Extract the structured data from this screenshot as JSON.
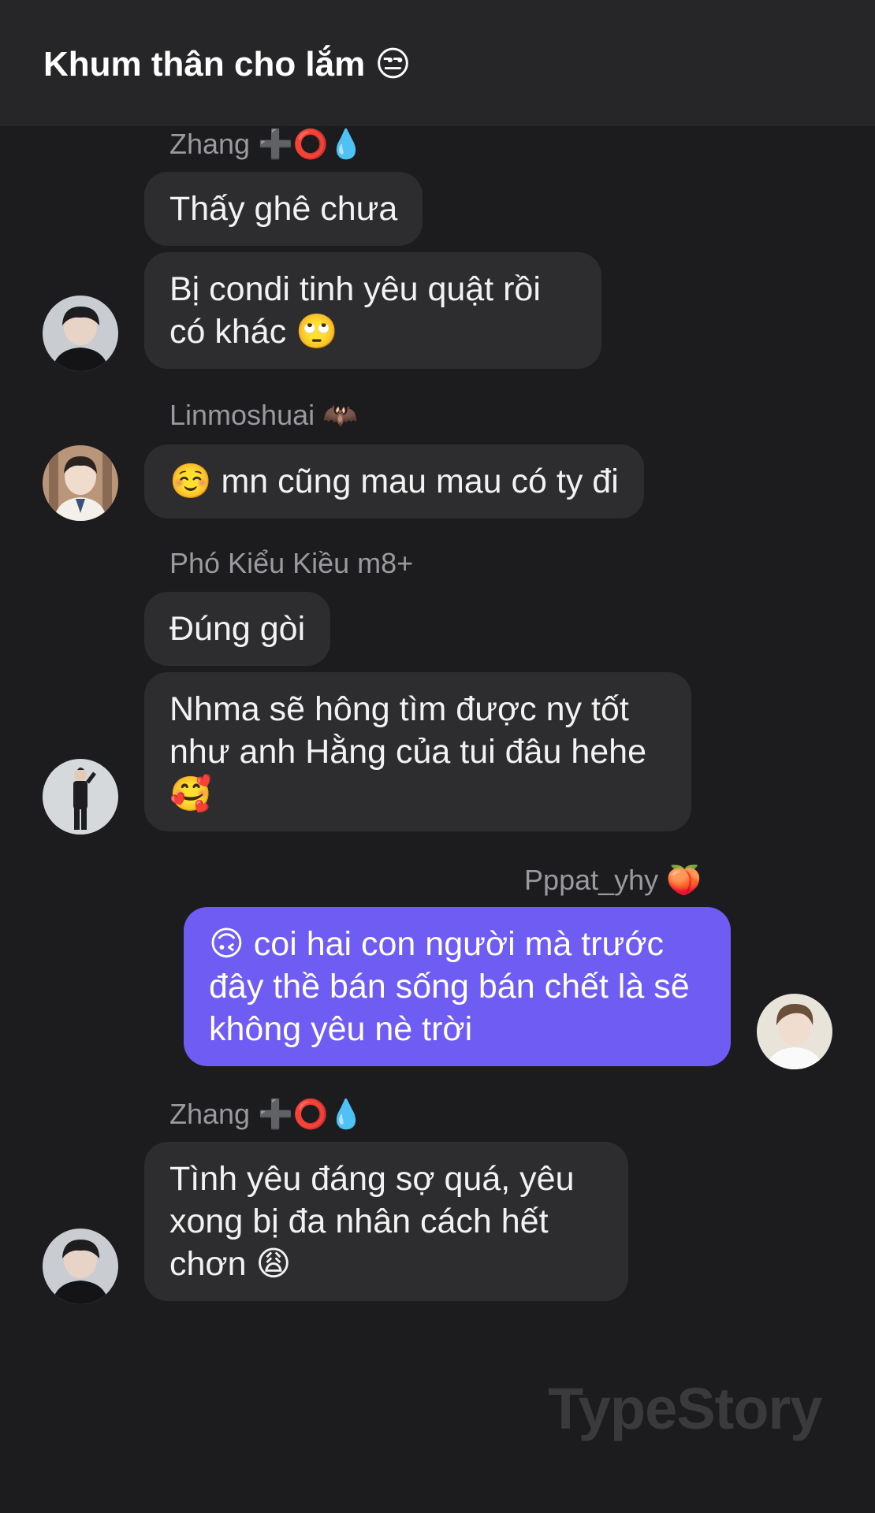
{
  "header": {
    "title": "Khum thân cho lắm 😒"
  },
  "messages": {
    "g1_name": "Zhang ➕⭕️💧",
    "g1_b1": "Thấy ghê chưa",
    "g1_b2": "Bị condi tinh yêu quật rồi có khác 🙄",
    "g2_name": "Linmoshuai 🦇",
    "g2_b1": "☺️ mn cũng mau mau có ty đi",
    "g3_name": "Phó Kiểu Kiều m8+",
    "g3_b1": "Đúng gòi",
    "g3_b2": "Nhma sẽ hông tìm được ny tốt như anh Hằng của tui đâu hehe 🥰",
    "g4_name": "Pppat_yhy 🍑",
    "g4_b1": "🙃 coi hai con người mà trước đây thề bán sống bán chết là sẽ không yêu nè trời",
    "g5_name": "Zhang ➕⭕️💧",
    "g5_b1": "Tình yêu đáng sợ quá, yêu xong bị đa nhân cách hết chơn 😩"
  },
  "watermark": "TypeStory",
  "colors": {
    "background": "#1c1c1e",
    "header": "#262628",
    "bubble_incoming": "#2d2d30",
    "bubble_outgoing": "#6f5cf3",
    "name_text": "#9a9a9e"
  }
}
